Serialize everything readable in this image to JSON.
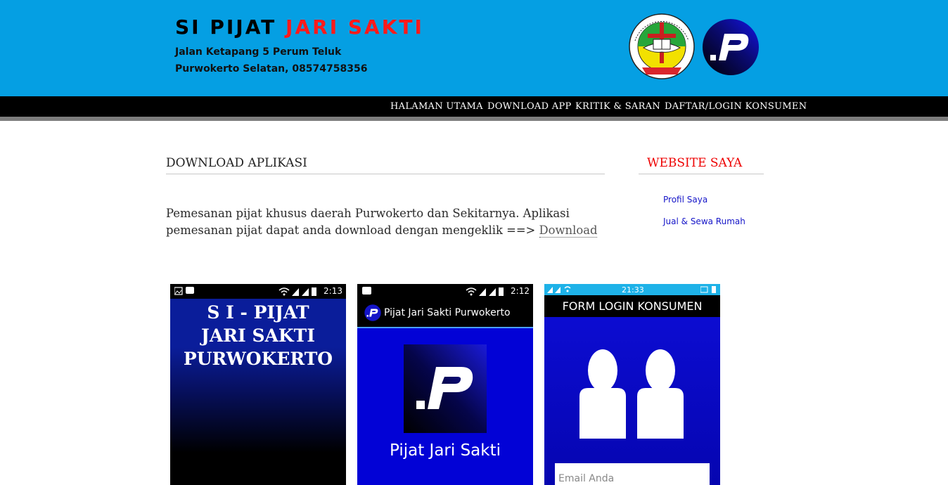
{
  "header": {
    "title_part1": "SI PIJAT ",
    "title_part2": "JARI SAKTI",
    "address_line1": "Jalan Ketapang 5 Perum Teluk",
    "address_line2": "Purwokerto Selatan, 08574758356",
    "logos": [
      "school-logo",
      "p-logo"
    ],
    "colors": {
      "background": "#059fe3",
      "title_accent": "#ff1a1a"
    }
  },
  "nav": {
    "items": [
      "HALAMAN UTAMA",
      "DOWNLOAD APP",
      "KRITIK & SARAN",
      "DAFTAR/LOGIN KONSUMEN"
    ]
  },
  "main": {
    "section_title": "DOWNLOAD APLIKASI",
    "paragraph_text": "Pemesanan pijat khusus daerah Purwokerto dan Sekitarnya. Aplikasi pemesanan pijat dapat anda download dengan mengeklik ==> ",
    "download_link": "Download"
  },
  "sidebar": {
    "title": "WEBSITE SAYA",
    "links": [
      "Profil Saya",
      "Jual & Sewa Rumah"
    ]
  },
  "screenshots": {
    "splash": {
      "time": "2:13",
      "line1": "S I - PIJAT",
      "line2": "JARI SAKTI",
      "line3": "PURWOKERTO"
    },
    "home": {
      "time": "2:12",
      "appbar_title": "Pijat Jari Sakti Purwokerto",
      "app_name": "Pijat Jari Sakti"
    },
    "login": {
      "time": "21:33",
      "form_title": "FORM LOGIN KONSUMEN",
      "email_placeholder": "Email Anda"
    }
  }
}
